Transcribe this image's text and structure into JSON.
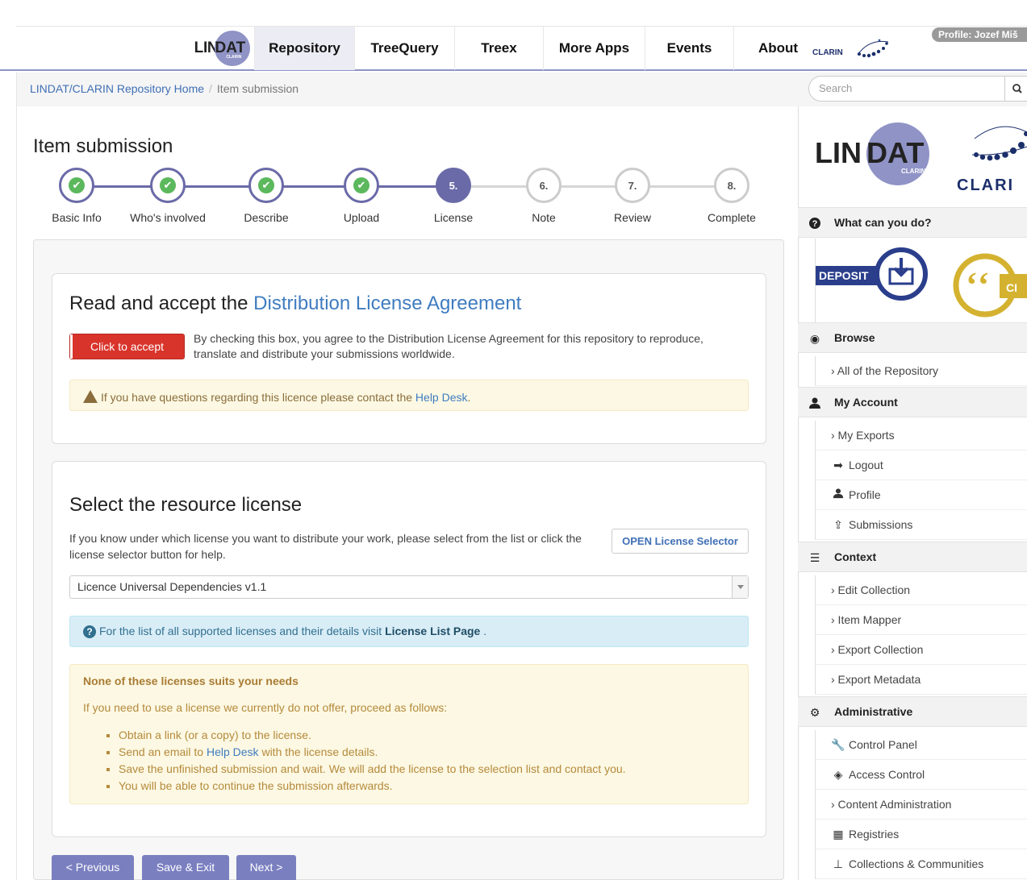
{
  "nav": {
    "logo_lin": "LIN",
    "logo_dat": "DAT",
    "logo_clarin": "CLARIN",
    "tabs": [
      {
        "label": "Repository",
        "active": true
      },
      {
        "label": "TreeQuery"
      },
      {
        "label": "Treex"
      },
      {
        "label": "More Apps"
      },
      {
        "label": "Events"
      },
      {
        "label": "About"
      }
    ],
    "clarin_text": "CLARIN",
    "profile": "Profile: Jozef Miš"
  },
  "breadcrumb": {
    "home": "LINDAT/CLARIN Repository Home",
    "separator": "/",
    "current": "Item submission"
  },
  "search": {
    "placeholder": "Search",
    "icon": "search-icon"
  },
  "page_title": "Item submission",
  "steps": [
    {
      "label": "Basic Info",
      "state": "done",
      "num": ""
    },
    {
      "label": "Who's involved",
      "state": "done",
      "num": ""
    },
    {
      "label": "Describe",
      "state": "done",
      "num": ""
    },
    {
      "label": "Upload",
      "state": "done",
      "num": ""
    },
    {
      "label": "License",
      "state": "active",
      "num": "5."
    },
    {
      "label": "Note",
      "state": "todo",
      "num": "6."
    },
    {
      "label": "Review",
      "state": "todo",
      "num": "7."
    },
    {
      "label": "Complete",
      "state": "todo",
      "num": "8."
    }
  ],
  "agreement": {
    "title_prefix": "Read and accept the ",
    "title_link": "Distribution License Agreement",
    "accept_button": "Click to accept",
    "accept_text": "By checking this box, you agree to the Distribution License Agreement for this repository to reproduce, translate and distribute your submissions worldwide.",
    "warning_text": "If you have questions regarding this licence please contact the ",
    "warning_link": "Help Desk",
    "warning_end": "."
  },
  "license": {
    "title": "Select the resource license",
    "intro": "If you know under which license you want to distribute your work, please select from the list or click the license selector button for help.",
    "open_button": "OPEN License Selector",
    "selected": "Licence Universal Dependencies v1.1",
    "info_text": "For the list of all supported licenses and their details visit ",
    "info_link": "License List Page",
    "info_end": " ."
  },
  "none_suits": {
    "title": "None of these licenses suits your needs",
    "intro": "If you need to use a license we currently do not offer, proceed as follows:",
    "item1": "Obtain a link (or a copy) to the license.",
    "item2_pre": "Send an email to ",
    "item2_link": "Help Desk",
    "item2_post": " with the license details.",
    "item3": "Save the unfinished submission and wait. We will add the license to the selection list and contact you.",
    "item4": "You will be able to continue the submission afterwards."
  },
  "buttons": {
    "previous": "< Previous",
    "save_exit": "Save & Exit",
    "next": "Next >"
  },
  "sidebar": {
    "logo_lin": "LIN",
    "logo_dat": "DAT",
    "logo_clarin_small": "CLARIN",
    "logo_clarin": "CLARI",
    "what_can_you_do": "What can you do?",
    "deposit": "DEPOSIT",
    "cite_text": "CI",
    "browse": "Browse",
    "all_repo": "› All of the Repository",
    "my_account": "My Account",
    "my_exports": "› My Exports",
    "logout": "Logout",
    "profile": "Profile",
    "submissions": "Submissions",
    "context": "Context",
    "edit_collection": "› Edit Collection",
    "item_mapper": "› Item Mapper",
    "export_collection": "› Export Collection",
    "export_metadata": "› Export Metadata",
    "administrative": "Administrative",
    "control_panel": "Control Panel",
    "access_control": "Access Control",
    "content_admin": "› Content Administration",
    "registries": "Registries",
    "collections": "Collections & Communities"
  },
  "colors": {
    "accent": "#6a6aa8",
    "nav_border": "#8f93c6",
    "accept": "#d9342b",
    "link": "#3f7cc0",
    "success": "#5cb85c"
  }
}
